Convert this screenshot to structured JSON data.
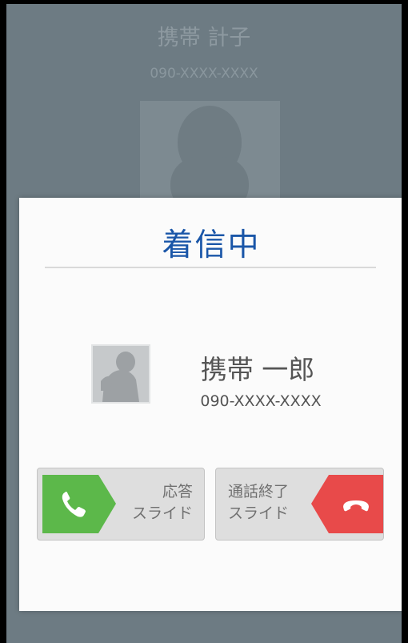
{
  "background_call": {
    "caller_name": "携帯 計子",
    "caller_number": "090-XXXX-XXXX"
  },
  "dialog": {
    "title": "着信中",
    "caller_name": "携帯 一郎",
    "caller_number": "090-XXXX-XXXX",
    "answer_slider": {
      "label_line1": "応答",
      "label_line2": "スライド",
      "icon": "phone-icon",
      "color": "#5cb84a"
    },
    "decline_slider": {
      "label_line1": "通話終了",
      "label_line2": "スライド",
      "icon": "hang-up-icon",
      "color": "#e84a4a"
    }
  },
  "colors": {
    "title": "#1a56a8",
    "background": "#6d7b83"
  }
}
